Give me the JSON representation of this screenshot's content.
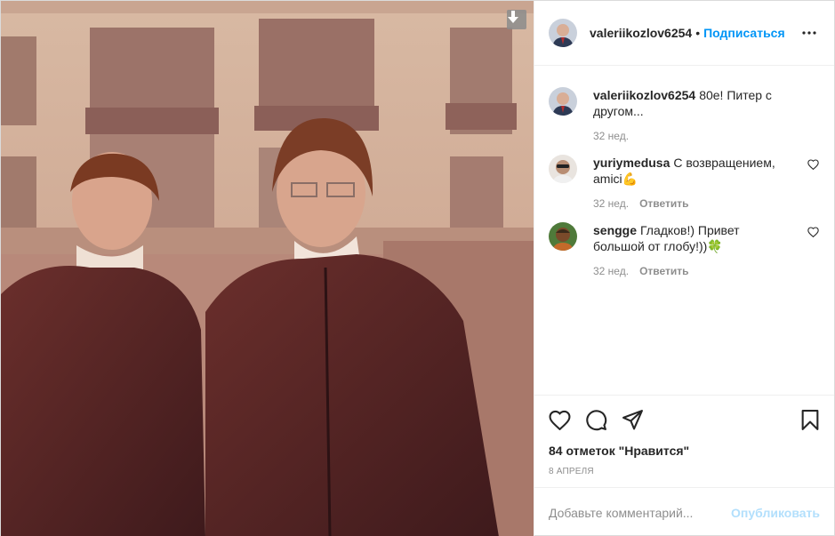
{
  "post": {
    "author": "valeriikozlov6254",
    "follow_label": "Подписаться",
    "dot": "•"
  },
  "comments": [
    {
      "user": "valeriikozlov6254",
      "text": "80е! Питер с другом...",
      "time": "32 нед.",
      "reply": ""
    },
    {
      "user": "yuriymedusa",
      "text": "С возвращением, amici💪",
      "time": "32 нед.",
      "reply": "Ответить"
    },
    {
      "user": "sengge",
      "text": "Гладков!) Привет большой от глобу!))🍀",
      "time": "32 нед.",
      "reply": "Ответить"
    }
  ],
  "actions": {
    "likes": "84 отметок \"Нравится\"",
    "date": "8 АПРЕЛЯ"
  },
  "add_comment": {
    "placeholder": "Добавьте комментарий...",
    "publish": "Опубликовать"
  },
  "colors": {
    "accent": "#0095f6",
    "publish_disabled": "#b2dffc",
    "muted": "#8e8e8e"
  }
}
